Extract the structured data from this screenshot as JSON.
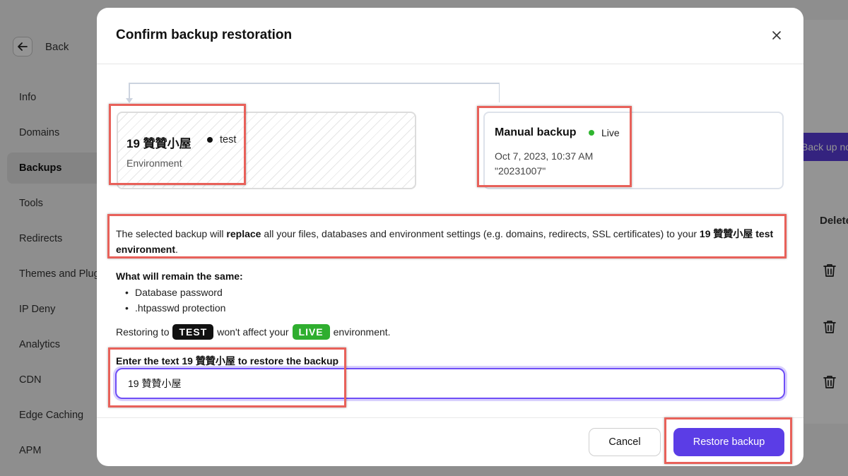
{
  "sidebar": {
    "back_label": "Back",
    "items": [
      {
        "label": "Info"
      },
      {
        "label": "Domains"
      },
      {
        "label": "Backups"
      },
      {
        "label": "Tools"
      },
      {
        "label": "Redirects"
      },
      {
        "label": "Themes and Plugins"
      },
      {
        "label": "IP Deny"
      },
      {
        "label": "Analytics"
      },
      {
        "label": "CDN"
      },
      {
        "label": "Edge Caching"
      },
      {
        "label": "APM"
      }
    ]
  },
  "background": {
    "backup_now_label": "Back up now",
    "delete_header": "Delete"
  },
  "modal": {
    "title": "Confirm backup restoration",
    "environment": {
      "name": "19 贊贊小屋",
      "tag": "test",
      "sub": "Environment"
    },
    "backup": {
      "name": "Manual backup",
      "status": "Live",
      "date": "Oct 7, 2023, 10:37 AM",
      "id": "\"20231007\""
    },
    "description": {
      "p1": "The selected backup will ",
      "b1": "replace",
      "p2": " all your files, databases and environment settings (e.g. domains, redirects, SSL certificates) to your ",
      "b2": "19 贊贊小屋 test environment",
      "p3": "."
    },
    "remain": {
      "title": "What will remain the same:",
      "items": [
        "Database password",
        ".htpasswd protection"
      ]
    },
    "restoring": {
      "prefix": "Restoring to",
      "test_pill": "TEST",
      "middle": "won't affect your",
      "live_pill": "LIVE",
      "suffix": "environment."
    },
    "confirm": {
      "label": "Enter the text 19 贊贊小屋 to restore the backup",
      "value": "19 贊贊小屋"
    },
    "cancel_label": "Cancel",
    "restore_label": "Restore backup"
  },
  "colors": {
    "accent": "#5b3de6",
    "live_green": "#2fae2f",
    "highlight_red": "#e8615a"
  }
}
